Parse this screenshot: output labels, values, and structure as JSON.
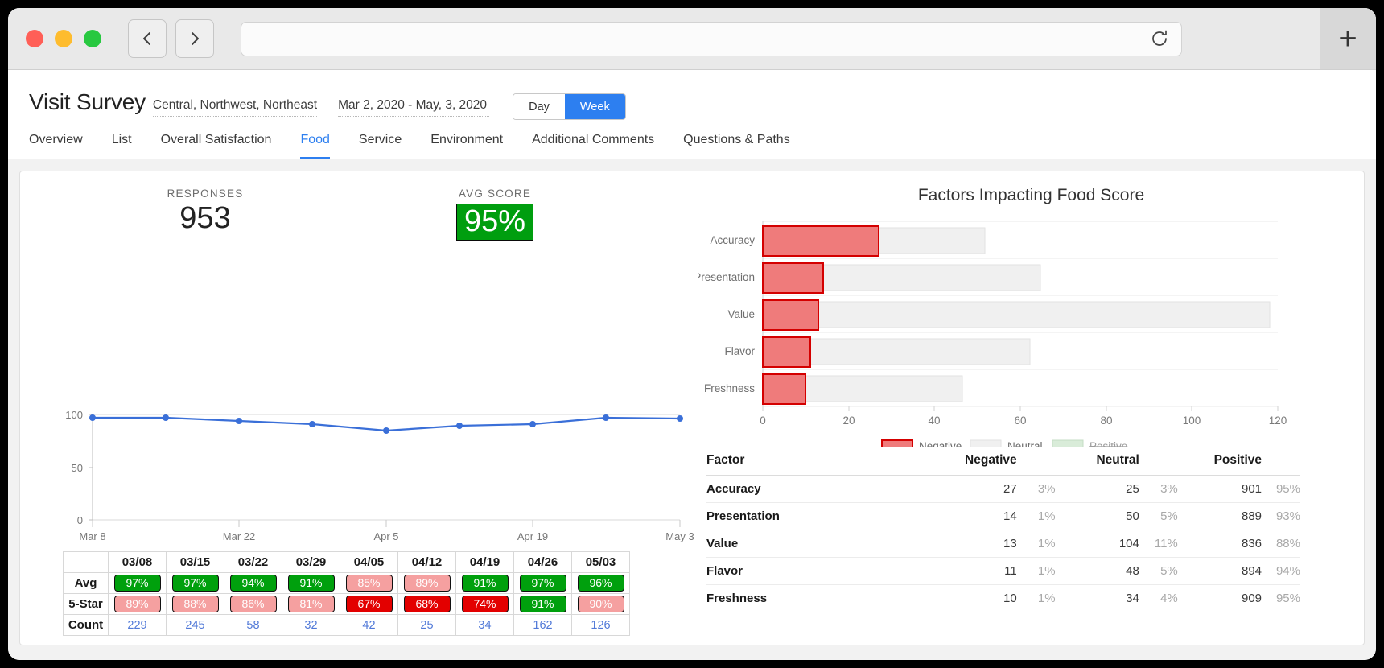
{
  "browser": {
    "back_icon": "chevron-left-icon",
    "forward_icon": "chevron-right-icon",
    "reload_icon": "reload-icon",
    "new_tab_icon": "plus-icon",
    "url_value": "",
    "url_placeholder": ""
  },
  "header": {
    "title": "Visit Survey",
    "filter": "Central, Northwest, Northeast",
    "date_range": "Mar 2, 2020 - May, 3, 2020",
    "granularity": {
      "options": [
        "Day",
        "Week"
      ],
      "selected": "Week"
    },
    "tabs": [
      {
        "label": "Overview",
        "active": false
      },
      {
        "label": "List",
        "active": false
      },
      {
        "label": "Overall Satisfaction",
        "active": false
      },
      {
        "label": "Food",
        "active": true
      },
      {
        "label": "Service",
        "active": false
      },
      {
        "label": "Environment",
        "active": false
      },
      {
        "label": "Additional Comments",
        "active": false
      },
      {
        "label": "Questions & Paths",
        "active": false
      }
    ]
  },
  "kpis": [
    {
      "label": "RESPONSES",
      "value": "953",
      "style": "plain"
    },
    {
      "label": "AVG SCORE",
      "value": "95%",
      "style": "green-badge"
    }
  ],
  "colors": {
    "accent": "#2d7ff0",
    "green": "#00a00d",
    "light_red": "#f5a0a0",
    "red": "#e30000",
    "line": "#3a6fd8",
    "bar_negative_fill": "#ef7b7b",
    "bar_negative_stroke": "#d40000",
    "bar_neutral_fill": "#efefef",
    "bar_positive_fill": "#d5ead5"
  },
  "chart_data": [
    {
      "type": "line",
      "title": "",
      "xlabel": "",
      "ylabel": "",
      "ylim": [
        0,
        100
      ],
      "yticks": [
        0,
        50,
        100
      ],
      "xticks": [
        "Mar 8",
        "Mar 22",
        "Apr 5",
        "Apr 19",
        "May 3"
      ],
      "categories": [
        "03/08",
        "03/15",
        "03/22",
        "03/29",
        "04/05",
        "04/12",
        "04/19",
        "04/26",
        "05/03"
      ],
      "values": [
        97,
        97,
        94,
        91,
        85,
        89,
        91,
        97,
        96
      ],
      "grid": true,
      "legend": "none"
    },
    {
      "type": "bar",
      "orientation": "horizontal",
      "title": "Factors Impacting Food Score",
      "categories": [
        "Accuracy",
        "Presentation",
        "Value",
        "Flavor",
        "Freshness"
      ],
      "series": [
        {
          "name": "Negative",
          "values": [
            27,
            14,
            13,
            11,
            10
          ]
        },
        {
          "name": "Neutral",
          "values": [
            25,
            50,
            104,
            48,
            34
          ]
        },
        {
          "name": "Positive",
          "values": [
            901,
            889,
            836,
            894,
            909
          ],
          "disabled": true
        }
      ],
      "xlabel": "",
      "ylabel": "",
      "xlim": [
        0,
        120
      ],
      "xticks": [
        0,
        20,
        40,
        60,
        80,
        100,
        120
      ],
      "grid": true,
      "legend": "bottom",
      "legend_entries": [
        {
          "label": "Negative",
          "disabled": false
        },
        {
          "label": "Neutral",
          "disabled": false
        },
        {
          "label": "Positive",
          "disabled": true
        }
      ]
    }
  ],
  "weekly_table": {
    "columns": [
      "03/08",
      "03/15",
      "03/22",
      "03/29",
      "04/05",
      "04/12",
      "04/19",
      "04/26",
      "05/03"
    ],
    "rows": [
      {
        "label": "Avg",
        "cells": [
          {
            "text": "97%",
            "style": "green"
          },
          {
            "text": "97%",
            "style": "green"
          },
          {
            "text": "94%",
            "style": "green"
          },
          {
            "text": "91%",
            "style": "green"
          },
          {
            "text": "85%",
            "style": "lightred"
          },
          {
            "text": "89%",
            "style": "lightred"
          },
          {
            "text": "91%",
            "style": "green"
          },
          {
            "text": "97%",
            "style": "green"
          },
          {
            "text": "96%",
            "style": "green"
          }
        ]
      },
      {
        "label": "5-Star",
        "cells": [
          {
            "text": "89%",
            "style": "lightred"
          },
          {
            "text": "88%",
            "style": "lightred"
          },
          {
            "text": "86%",
            "style": "lightred"
          },
          {
            "text": "81%",
            "style": "lightred"
          },
          {
            "text": "67%",
            "style": "red"
          },
          {
            "text": "68%",
            "style": "red"
          },
          {
            "text": "74%",
            "style": "red"
          },
          {
            "text": "91%",
            "style": "green"
          },
          {
            "text": "90%",
            "style": "lightred"
          }
        ]
      },
      {
        "label": "Count",
        "cells": [
          {
            "text": "229",
            "style": "count"
          },
          {
            "text": "245",
            "style": "count"
          },
          {
            "text": "58",
            "style": "count"
          },
          {
            "text": "32",
            "style": "count"
          },
          {
            "text": "42",
            "style": "count"
          },
          {
            "text": "25",
            "style": "count"
          },
          {
            "text": "34",
            "style": "count"
          },
          {
            "text": "162",
            "style": "count"
          },
          {
            "text": "126",
            "style": "count"
          }
        ]
      }
    ]
  },
  "factors_table": {
    "headers": [
      "Factor",
      "Negative",
      "Neutral",
      "Positive"
    ],
    "rows": [
      {
        "factor": "Accuracy",
        "neg": "27",
        "neg_pct": "3%",
        "neu": "25",
        "neu_pct": "3%",
        "pos": "901",
        "pos_pct": "95%"
      },
      {
        "factor": "Presentation",
        "neg": "14",
        "neg_pct": "1%",
        "neu": "50",
        "neu_pct": "5%",
        "pos": "889",
        "pos_pct": "93%"
      },
      {
        "factor": "Value",
        "neg": "13",
        "neg_pct": "1%",
        "neu": "104",
        "neu_pct": "11%",
        "pos": "836",
        "pos_pct": "88%"
      },
      {
        "factor": "Flavor",
        "neg": "11",
        "neg_pct": "1%",
        "neu": "48",
        "neu_pct": "5%",
        "pos": "894",
        "pos_pct": "94%"
      },
      {
        "factor": "Freshness",
        "neg": "10",
        "neg_pct": "1%",
        "neu": "34",
        "neu_pct": "4%",
        "pos": "909",
        "pos_pct": "95%"
      }
    ]
  }
}
